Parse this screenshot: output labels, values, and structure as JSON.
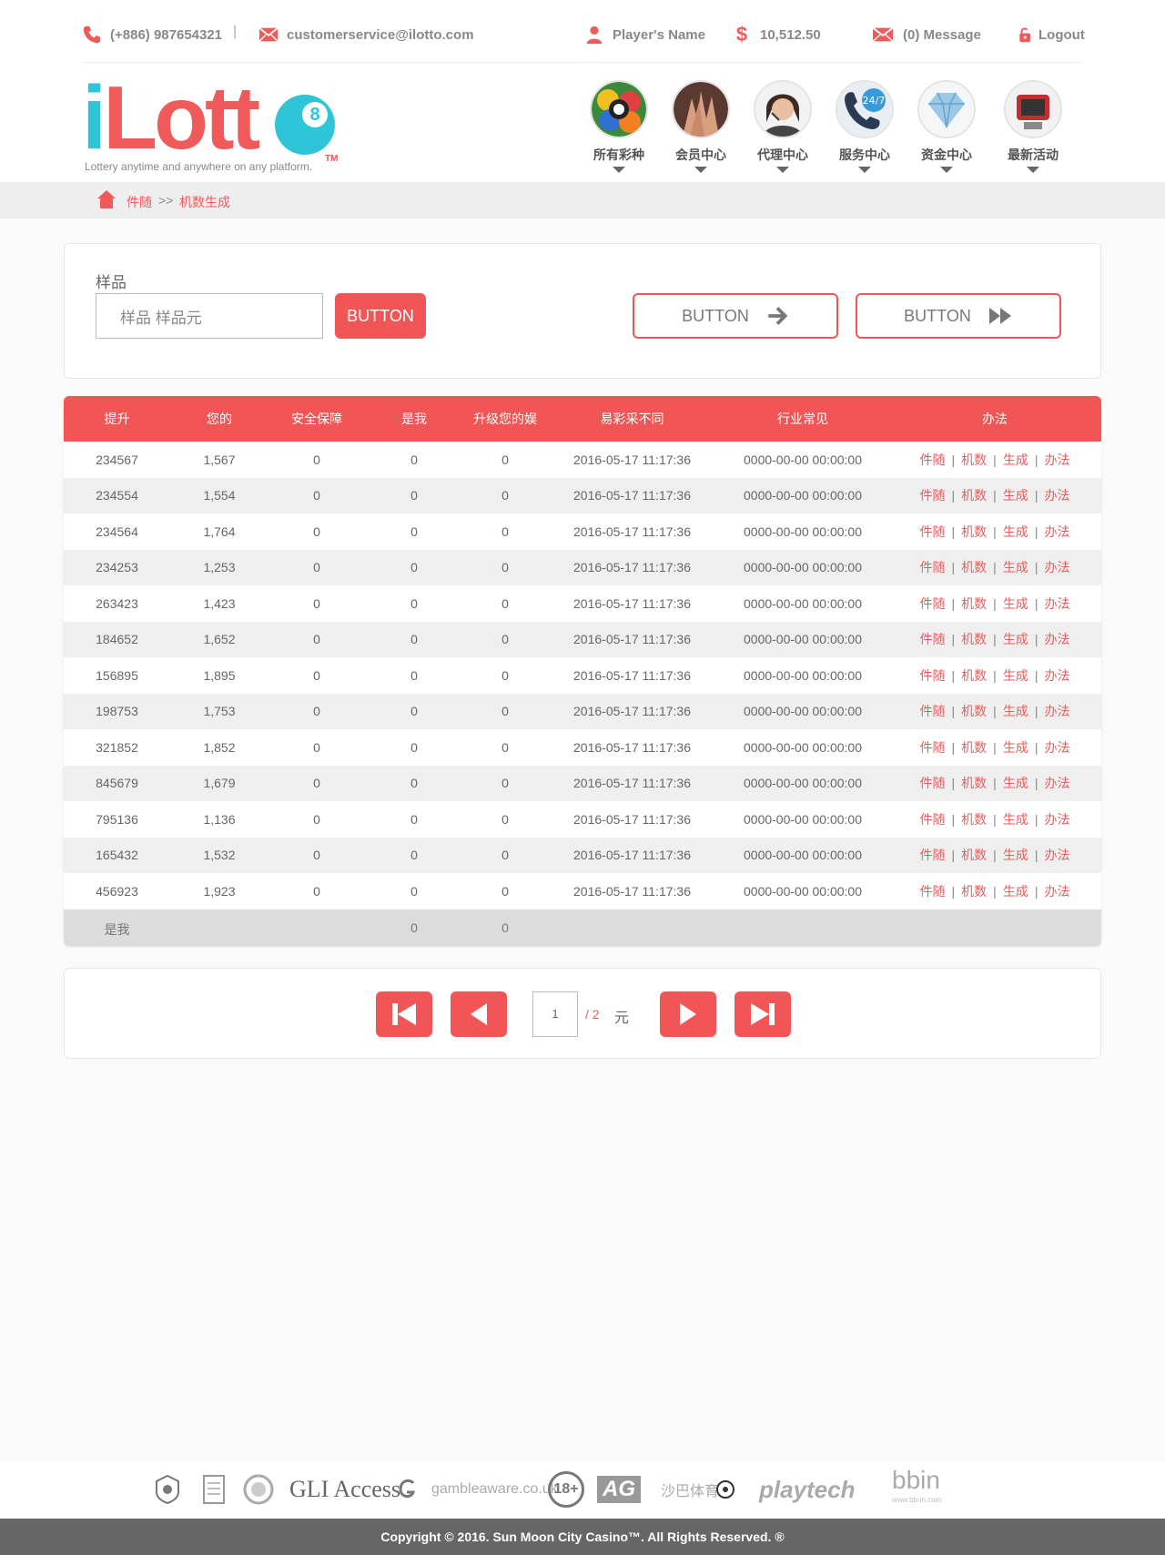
{
  "topbar": {
    "phone": "(+886) 987654321",
    "separator": "|",
    "email": "customerservice@ilotto.com",
    "player_name": "Player's Name",
    "balance": "10,512.50",
    "message": "(0) Message",
    "logout": "Logout"
  },
  "logo": {
    "i": "i",
    "lott": "Lott",
    "ball_number": "8",
    "tm": "TM",
    "tagline": "Lottery anytime and anywhere on any platform."
  },
  "nav": [
    {
      "label": "所有彩种",
      "icon": "lottery-balls-icon"
    },
    {
      "label": "会员中心",
      "icon": "hands-together-icon"
    },
    {
      "label": "代理中心",
      "icon": "agent-headset-icon"
    },
    {
      "label": "服务中心",
      "icon": "phone-24-7-icon"
    },
    {
      "label": "资金中心",
      "icon": "diamond-icon"
    },
    {
      "label": "最新活动",
      "icon": "tv-events-icon"
    }
  ],
  "breadcrumb": {
    "home": "件随",
    "separator": ">>",
    "current": "机数生成"
  },
  "search": {
    "label": "样品",
    "input_value": "样品 样品元",
    "button": "BUTTON",
    "next_button": "BUTTON",
    "last_button": "BUTTON"
  },
  "table": {
    "headers": [
      "提升",
      "您的",
      "安全保障",
      "是我",
      "升级您的娱",
      "易彩采不同",
      "行业常见",
      "办法"
    ],
    "rows": [
      [
        "234567",
        "1,567",
        "0",
        "0",
        "0",
        "2016-05-17 11:17:36",
        "0000-00-00 00:00:00"
      ],
      [
        "234554",
        "1,554",
        "0",
        "0",
        "0",
        "2016-05-17 11:17:36",
        "0000-00-00 00:00:00"
      ],
      [
        "234564",
        "1,764",
        "0",
        "0",
        "0",
        "2016-05-17 11:17:36",
        "0000-00-00 00:00:00"
      ],
      [
        "234253",
        "1,253",
        "0",
        "0",
        "0",
        "2016-05-17 11:17:36",
        "0000-00-00 00:00:00"
      ],
      [
        "263423",
        "1,423",
        "0",
        "0",
        "0",
        "2016-05-17 11:17:36",
        "0000-00-00 00:00:00"
      ],
      [
        "184652",
        "1,652",
        "0",
        "0",
        "0",
        "2016-05-17 11:17:36",
        "0000-00-00 00:00:00"
      ],
      [
        "156895",
        "1,895",
        "0",
        "0",
        "0",
        "2016-05-17 11:17:36",
        "0000-00-00 00:00:00"
      ],
      [
        "198753",
        "1,753",
        "0",
        "0",
        "0",
        "2016-05-17 11:17:36",
        "0000-00-00 00:00:00"
      ],
      [
        "321852",
        "1,852",
        "0",
        "0",
        "0",
        "2016-05-17 11:17:36",
        "0000-00-00 00:00:00"
      ],
      [
        "845679",
        "1,679",
        "0",
        "0",
        "0",
        "2016-05-17 11:17:36",
        "0000-00-00 00:00:00"
      ],
      [
        "795136",
        "1,136",
        "0",
        "0",
        "0",
        "2016-05-17 11:17:36",
        "0000-00-00 00:00:00"
      ],
      [
        "165432",
        "1,532",
        "0",
        "0",
        "0",
        "2016-05-17 11:17:36",
        "0000-00-00 00:00:00"
      ],
      [
        "456923",
        "1,923",
        "0",
        "0",
        "0",
        "2016-05-17 11:17:36",
        "0000-00-00 00:00:00"
      ]
    ],
    "actions": [
      "件随",
      "机数",
      "生成",
      "办法"
    ],
    "action_separator": "|",
    "footer": {
      "label": "是我",
      "col4": "0",
      "col5": "0"
    }
  },
  "pagination": {
    "current": "1",
    "total": "/ 2",
    "unit": "元"
  },
  "partners": [
    "GLI Access",
    "gambleaware.co.uk",
    "18+",
    "AG",
    "沙巴体育",
    "playtech",
    "bbin",
    "www.bb-in.com"
  ],
  "footer": {
    "copyright": "Copyright © 2016. Sun Moon City Casino™. All Rights Reserved. ®"
  },
  "colors": {
    "accent": "#f25555",
    "logo_blue": "#2ec5d8",
    "footer_bg": "#666666"
  }
}
